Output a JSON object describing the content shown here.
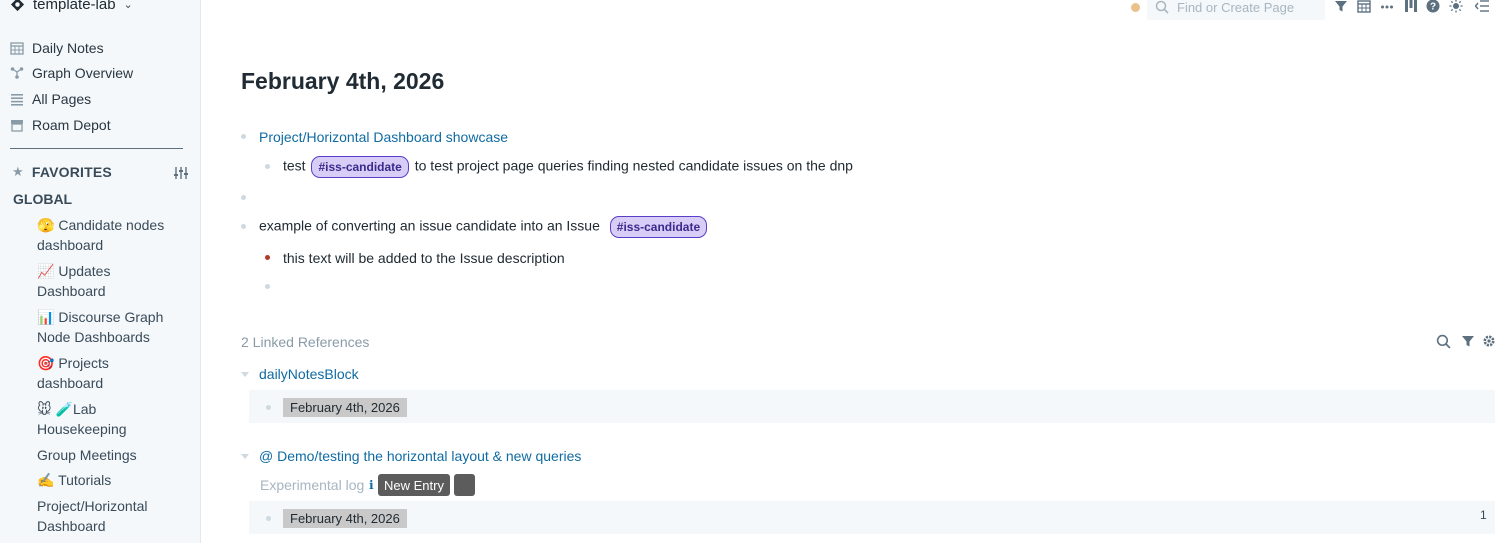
{
  "sidebar": {
    "graph_name": "template-lab",
    "nav": [
      {
        "label": "Daily Notes",
        "icon": "calendar-icon"
      },
      {
        "label": "Graph Overview",
        "icon": "graph-icon"
      },
      {
        "label": "All Pages",
        "icon": "list-icon"
      },
      {
        "label": "Roam Depot",
        "icon": "shop-icon"
      }
    ],
    "favorites_label": "FAVORITES",
    "global_label": "GLOBAL",
    "shortcuts": [
      {
        "emoji": "🫣",
        "line1": " Candidate nodes",
        "line2": "dashboard"
      },
      {
        "emoji": "📈",
        "line1": " Updates",
        "line2": "Dashboard"
      },
      {
        "emoji": "📊",
        "line1": " Discourse Graph",
        "line2": "Node Dashboards"
      },
      {
        "emoji": "🎯",
        "line1": " Projects",
        "line2": "dashboard"
      },
      {
        "emoji": "🐭 🧪",
        "line1": "Lab",
        "line2": "Housekeeping"
      },
      {
        "emoji": "",
        "line1": "Group Meetings",
        "line2": ""
      },
      {
        "emoji": "✍️",
        "line1": " Tutorials",
        "line2": ""
      },
      {
        "emoji": "",
        "line1": "Project/Horizontal",
        "line2": "Dashboard"
      }
    ]
  },
  "topbar": {
    "search_placeholder": "Find or Create Page",
    "status_color": "#e8c28a"
  },
  "page": {
    "title": "February 4th, 2026",
    "blocks": {
      "b1_link": "Project/Horizontal Dashboard showcase",
      "b2_pre": "test",
      "b2_tag": "#iss-candidate",
      "b2_post": "to test project page queries finding nested candidate issues on the dnp",
      "b4_text": "example of converting an issue candidate into an Issue",
      "b4_tag": "#iss-candidate",
      "b5_text": "this text will be added to the Issue description"
    },
    "linked_refs": {
      "title": "2 Linked References",
      "group1_title": "dailyNotesBlock",
      "group1_date": "February 4th, 2026",
      "group2_title": "@ Demo/testing the horizontal layout & new queries",
      "experimental_label": "Experimental log",
      "info_symbol": "ℹ",
      "new_entry_label": "New Entry",
      "group2_date": "February 4th, 2026",
      "group2_count": "1"
    }
  },
  "colors": {
    "link": "#106ba3",
    "tag_bg": "#d8cdf7",
    "tag_border": "#5a3ec8",
    "sidebar_bg": "#f5f8fa",
    "date_chip_bg": "#c9c9c9",
    "button_dark": "#5c5c5c"
  }
}
